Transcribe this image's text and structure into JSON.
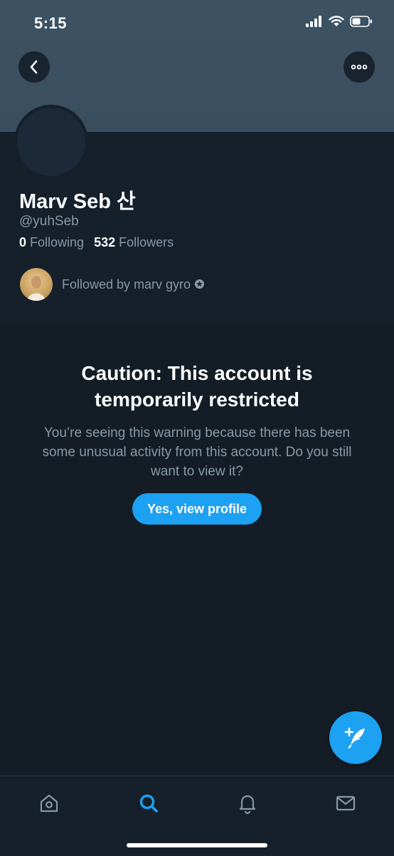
{
  "status_bar": {
    "time": "5:15"
  },
  "profile": {
    "display_name": "Marv Seb 산",
    "handle": "@yuhSeb",
    "following_count": "0",
    "following_label": "Following",
    "followers_count": "532",
    "followers_label": "Followers",
    "followed_by": "Followed by marv gyro"
  },
  "warning": {
    "title": "Caution: This account is temporarily restricted",
    "body": "You’re seeing this warning because there has been some unusual activity from this account. Do you still want to view it?",
    "button_label": "Yes, view profile"
  },
  "tabs": [
    {
      "name": "home",
      "icon": "home-icon",
      "active": false
    },
    {
      "name": "search",
      "icon": "search-icon",
      "active": true
    },
    {
      "name": "notifications",
      "icon": "bell-icon",
      "active": false
    },
    {
      "name": "messages",
      "icon": "mail-icon",
      "active": false
    }
  ],
  "colors": {
    "accent": "#1da1f2",
    "background": "#141d26",
    "profile_bg": "#15202b",
    "banner": "#3d5263",
    "secondary_text": "#8899a6"
  }
}
